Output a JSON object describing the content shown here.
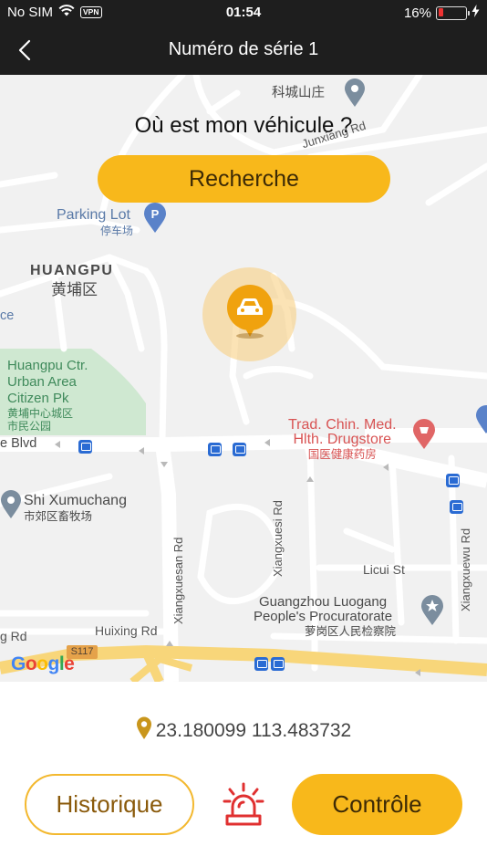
{
  "status_bar": {
    "carrier": "No SIM",
    "vpn": "VPN",
    "time": "01:54",
    "battery": "16%"
  },
  "nav": {
    "title": "Numéro de série 1"
  },
  "map": {
    "heading": "Où est mon véhicule ?",
    "search_label": "Recherche",
    "labels": {
      "kecheng": "科城山庄",
      "junxiang": "Junxiang Rd",
      "parking": "Parking Lot",
      "parking_cn": "停车场",
      "huangpu": "HUANGPU",
      "huangpu_cn": "黄埔区",
      "ce": "ce",
      "park_line1": "Huangpu Ctr.",
      "park_line2": "Urban Area",
      "park_line3": "Citizen Pk",
      "park_cn1": "黄埔中心城区",
      "park_cn2": "市民公园",
      "tcm_line1": "Trad. Chin. Med.",
      "tcm_line2": "Hlth. Drugstore",
      "tcm_cn": "国医健康药房",
      "blvd": "e Blvd",
      "shixu": "Shi Xumuchang",
      "shixu_cn": "市郊区畜牧场",
      "xiangxuesi": "Xiangxuesi Rd",
      "xiangxuesan": "Xiangxuesan Rd",
      "xiangxuewu": "Xiangxuewu Rd",
      "licui": "Licui St",
      "proc_line1": "Guangzhou Luogang",
      "proc_line2": "People's Procuratorate",
      "proc_cn": "萝岗区人民检察院",
      "huixing": "Huixing Rd",
      "g_rd": "g Rd",
      "s117": "S117",
      "google": "Google"
    }
  },
  "location": {
    "coords": "23.180099 113.483732"
  },
  "actions": {
    "history_label": "Historique",
    "control_label": "Contrôle"
  },
  "colors": {
    "accent": "#f8b81b",
    "topbar": "#1e1e1e",
    "alarm": "#e03030"
  },
  "icons": {
    "back": "chevron-left-icon",
    "vehicle": "car-icon",
    "location": "map-pin-icon",
    "alarm": "siren-icon"
  }
}
